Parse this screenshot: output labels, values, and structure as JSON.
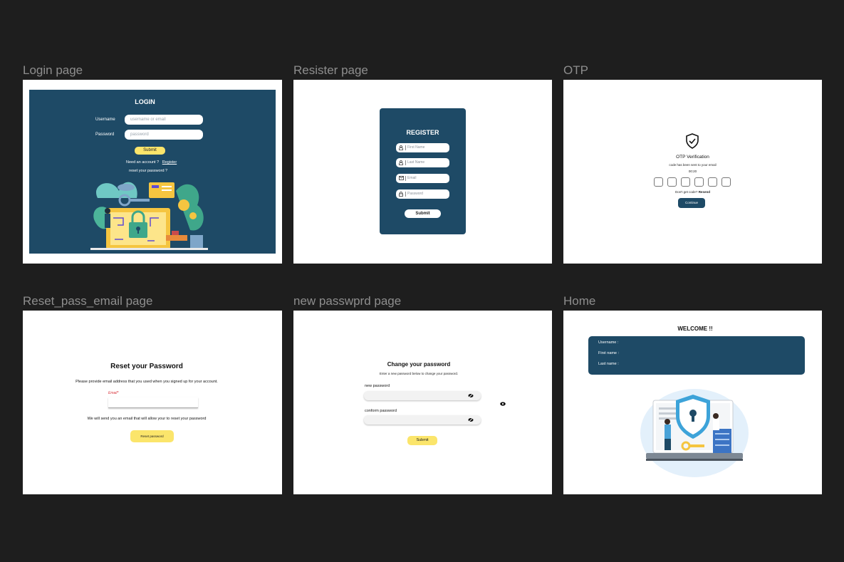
{
  "frames": {
    "login": {
      "label": "Login page"
    },
    "register": {
      "label": "Resister page"
    },
    "otp": {
      "label": "OTP"
    },
    "reset": {
      "label": "Reset_pass_email page"
    },
    "newpass": {
      "label": "new passwprd page"
    },
    "home": {
      "label": "Home"
    }
  },
  "login": {
    "title": "LOGIN",
    "username_label": "Username",
    "username_placeholder": "username or email",
    "password_label": "Password",
    "password_placeholder": "password",
    "submit": "Submit",
    "need_account": "Need an account ?",
    "register_link": "Register",
    "reset_link": "reset your password ?"
  },
  "register": {
    "title": "REGISTER",
    "first_name": "First Name",
    "last_name": "Last Name",
    "email": "Email",
    "password": "Password",
    "submit": "Submit"
  },
  "otp": {
    "title": "OTP Verification",
    "subtitle": "code has been sent to your email",
    "timer": "00:20",
    "no_code": "Don't get code?",
    "resend": "Resend",
    "continue": "Continue"
  },
  "reset": {
    "title": "Reset your Password",
    "instruction": "Please provide email address that you used when you signed up for your account.",
    "email_label": "Email*",
    "note": "We will send you an email that will allow your to reset your password",
    "button": "Reset password"
  },
  "newpass": {
    "title": "Change your password",
    "subtitle": "Enter a new password below to change your password.",
    "new_label": "new password",
    "confirm_label": "conform password",
    "submit": "Submit"
  },
  "home": {
    "title": "WELCOME !!",
    "username": "Username :",
    "first_name": "First name :",
    "last_name": "Last name :"
  },
  "colors": {
    "navy": "#1e4a66",
    "yellow": "#fbe56b",
    "background": "#1e1e1e"
  }
}
